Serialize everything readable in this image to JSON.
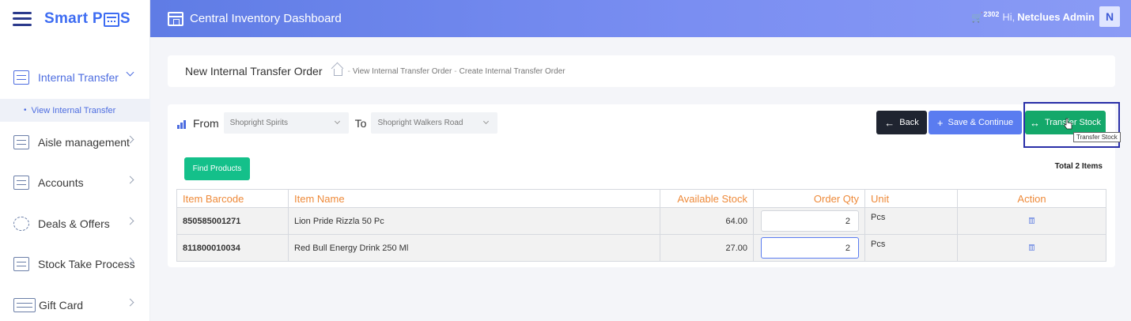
{
  "brand": {
    "name_part1": "Smart P",
    "name_part2": "S"
  },
  "header": {
    "title": "Central Inventory Dashboard",
    "cart_count": "2302",
    "greeting": "Hi,",
    "user_name": "Netclues Admin",
    "avatar_letter": "N"
  },
  "sidebar": {
    "items": [
      {
        "label": "Internal Transfer",
        "icon": "transfer-icon",
        "active": true
      },
      {
        "label": "Aisle management",
        "icon": "aisle-icon"
      },
      {
        "label": "Accounts",
        "icon": "accounts-icon"
      },
      {
        "label": "Deals & Offers",
        "icon": "discount-icon"
      },
      {
        "label": "Stock Take Process",
        "icon": "stock-take-icon"
      },
      {
        "label": "Gift Card",
        "icon": "gift-card-icon"
      }
    ],
    "subitem": "View Internal Transfer"
  },
  "breadcrumb": {
    "page_title": "New Internal Transfer Order",
    "crumb1": "View Internal Transfer Order",
    "crumb2": "Create Internal Transfer Order"
  },
  "form": {
    "from_label": "From",
    "from_value": "Shopright Spirits",
    "to_label": "To",
    "to_value": "Shopright Walkers Road"
  },
  "buttons": {
    "back": "Back",
    "save": "Save & Continue",
    "transfer": "Transfer Stock",
    "tooltip": "Transfer Stock",
    "find": "Find Products"
  },
  "total_items": "Total 2 Items",
  "table": {
    "headers": [
      "Item Barcode",
      "Item Name",
      "Available Stock",
      "Order Qty",
      "Unit",
      "Action"
    ],
    "rows": [
      {
        "barcode": "850585001271",
        "name": "Lion Pride Rizzla 50 Pc",
        "stock": "64.00",
        "qty": "2",
        "unit": "Pcs"
      },
      {
        "barcode": "811800010034",
        "name": "Red Bull Energy Drink 250 Ml",
        "stock": "27.00",
        "qty": "2",
        "unit": "Pcs"
      }
    ]
  },
  "colors": {
    "accent": "#5a7cf0",
    "success": "#14a86a",
    "header_orange": "#ee8a3a"
  }
}
